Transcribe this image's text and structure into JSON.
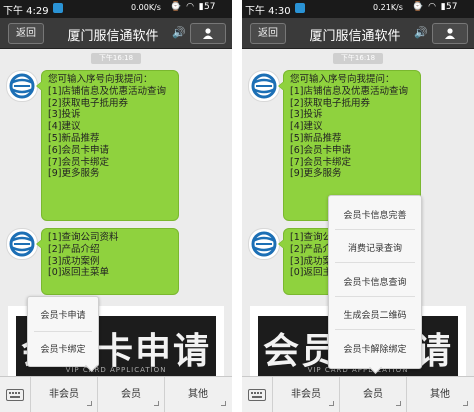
{
  "left": {
    "status": {
      "time": "下午 4:29",
      "speed": "0.00K/s",
      "battery": "57"
    },
    "title": "厦门服信通软件",
    "back_label": "返回",
    "timestamp": "下午16:18",
    "messages": [
      {
        "lines": [
          "您可输入序号向我提问：",
          "[1]店铺信息及优惠活动查询",
          "[2]获取电子抵用券",
          "[3]投诉",
          "[4]建议",
          "[5]新品推荐",
          "[6]会员卡申请",
          "[7]会员卡绑定",
          "[9]更多服务"
        ]
      },
      {
        "lines": [
          "[1]查询公司资料",
          "[2]产品介绍",
          "[3]成功案例",
          "[0]返回主菜单"
        ]
      }
    ],
    "banner": {
      "text": "会员卡申请",
      "sub": "VIP CARD APPLICATION"
    },
    "tabs": [
      "非会员",
      "会员",
      "其他"
    ],
    "popup": {
      "items": [
        "会员卡申请",
        "会员卡绑定"
      ]
    }
  },
  "right": {
    "status": {
      "time": "下午 4:30",
      "speed": "0.21K/s",
      "battery": "57"
    },
    "title": "厦门服信通软件",
    "back_label": "返回",
    "timestamp": "下午16:18",
    "messages": [
      {
        "lines": [
          "您可输入序号向我提问：",
          "[1]店铺信息及优惠活动查询",
          "[2]获取电子抵用券",
          "[3]投诉",
          "[4]建议",
          "[5]新品推荐",
          "[6]会员卡申请",
          "[7]会员卡绑定",
          "[9]更多服务"
        ]
      },
      {
        "lines": [
          "[1]查询公司资料",
          "[2]产品介绍",
          "[3]成功案例",
          "[0]返回主菜单"
        ]
      }
    ],
    "banner": {
      "text": "会员卡申请",
      "sub": "VIP CARD APPLICATION"
    },
    "tabs": [
      "非会员",
      "会员",
      "其他"
    ],
    "popup": {
      "items": [
        "会员卡信息完善",
        "消费记录查询",
        "会员卡信息查询",
        "生成会员二维码",
        "会员卡解除绑定"
      ]
    }
  }
}
